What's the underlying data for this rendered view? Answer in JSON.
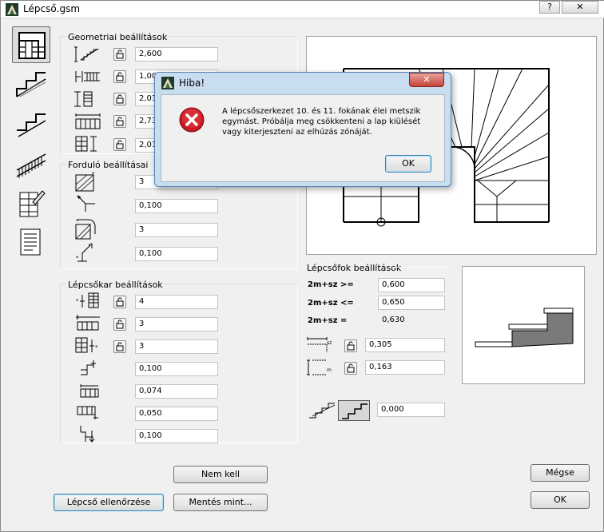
{
  "window": {
    "title": "Lépcső.gsm",
    "help_label": "?",
    "close_label": "✕"
  },
  "geometry": {
    "header": "Geometriai beállítások",
    "fields": [
      "2,600",
      "1,00",
      "2,01",
      "2,73",
      "2,01"
    ]
  },
  "landing": {
    "header": "Forduló beállításai",
    "fields": [
      "3",
      "0,100",
      "3",
      "0,100"
    ]
  },
  "flight": {
    "header": "Lépcsőkar beállítások",
    "fields": [
      "4",
      "3",
      "3",
      "0,100",
      "0,074",
      "0,050",
      "0,100"
    ]
  },
  "steps": {
    "header": "Lépcsőfok beállítások",
    "rule1_label": "2m+sz >=",
    "rule1_value": "0,600",
    "rule2_label": "2m+sz <=",
    "rule2_value": "0,650",
    "result_label": "2m+sz =",
    "result_value": "0,630",
    "tread_value": "0,305",
    "riser_value": "0,163",
    "nosing_value": "0,000"
  },
  "buttons": {
    "nem_kell": "Nem kell",
    "check": "Lépcső ellenőrzése",
    "save_as": "Mentés mint...",
    "cancel": "Mégse",
    "ok": "OK"
  },
  "error_dialog": {
    "title": "Hiba!",
    "message": "A lépcsőszerkezet 10. és 11. fokának élei metszik egymást. Próbálja meg csökkenteni a lap kiülését vagy kiterjeszteni az elhúzás zónáját.",
    "ok": "OK",
    "close": "✕"
  }
}
